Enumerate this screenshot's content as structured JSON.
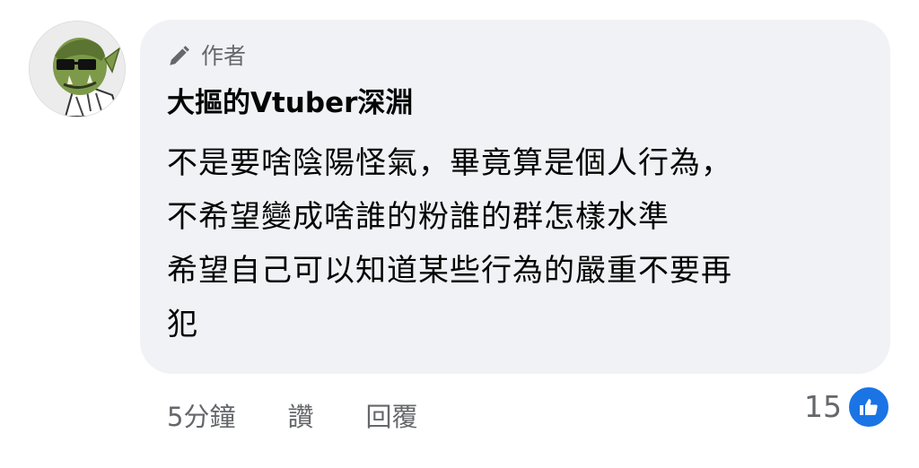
{
  "comment": {
    "avatar_icon": "orc-avatar-icon",
    "badge": {
      "icon": "pencil-icon",
      "label": "作者"
    },
    "author_name": "大摳的Vtuber深淵",
    "lines": [
      "不是要啥陰陽怪氣，畢竟算是個人行為，",
      "不希望變成啥誰的粉誰的群怎樣水準",
      "希望自己可以知道某些行為的嚴重不要再",
      "犯"
    ],
    "actions": {
      "time": "5分鐘",
      "like": "讚",
      "reply": "回覆"
    },
    "reactions": {
      "count": "15",
      "icon": "thumbs-up-icon",
      "color": "#1b74e4"
    },
    "bubble_color": "#f0f2f5"
  }
}
